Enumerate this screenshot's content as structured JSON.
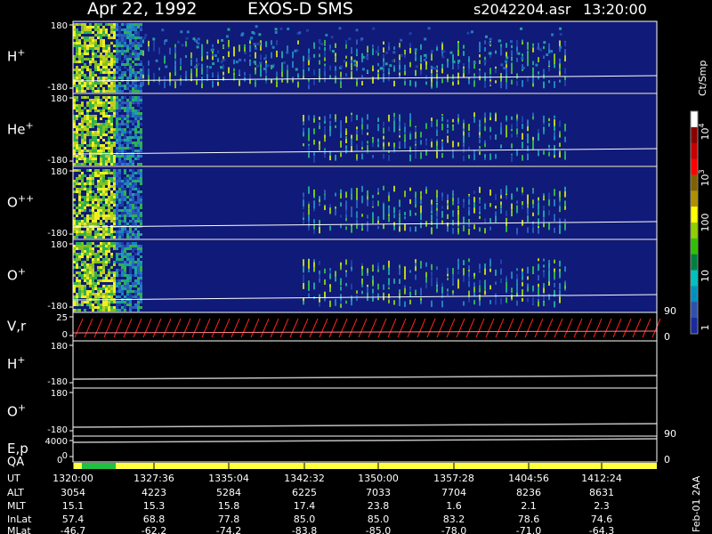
{
  "header": {
    "date": "Apr 22, 1992",
    "instrument": "EXOS-D SMS",
    "file": "s2042204.asr",
    "time": "13:20:00"
  },
  "colorbar": {
    "unit": "Ct/Smp",
    "ticks": [
      {
        "label": "10",
        "sup": "4",
        "value": 10000
      },
      {
        "label": "10",
        "sup": "3",
        "value": 1000
      },
      {
        "label": "100",
        "sup": "",
        "value": 100
      },
      {
        "label": "10",
        "sup": "",
        "value": 10
      },
      {
        "label": "1",
        "sup": "",
        "value": 1
      }
    ],
    "colors": [
      "#ffffff",
      "#8b0000",
      "#c80000",
      "#ff0000",
      "#806000",
      "#b09000",
      "#ffff00",
      "#90d000",
      "#30c000",
      "#008040",
      "#00c0c0",
      "#0090c0",
      "#3050b0",
      "#1a2aa0"
    ]
  },
  "side_labels": [
    "90",
    "0",
    "90",
    "0"
  ],
  "footer_side": "Feb-01 2AA",
  "chart_data": [
    {
      "type": "heatmap",
      "name": "H",
      "sup": "+",
      "ylim": [
        -180,
        180
      ],
      "ticks": [
        "180",
        "-180"
      ],
      "bg": "#101a78"
    },
    {
      "type": "heatmap",
      "name": "He",
      "sup": "+",
      "ylim": [
        -180,
        180
      ],
      "ticks": [
        "180",
        "-180"
      ],
      "bg": "#101a78"
    },
    {
      "type": "heatmap",
      "name": "O",
      "sup": "++",
      "ylim": [
        -180,
        180
      ],
      "ticks": [
        "180",
        "-180"
      ],
      "bg": "#101a78"
    },
    {
      "type": "heatmap",
      "name": "O",
      "sup": "+",
      "ylim": [
        -180,
        180
      ],
      "ticks": [
        "180",
        "-180"
      ],
      "bg": "#101a78"
    },
    {
      "type": "line",
      "name": "V,r",
      "sup": "",
      "ticks": [
        "25",
        "0"
      ],
      "bg": "#000000"
    },
    {
      "type": "line",
      "name": "H",
      "sup": "+",
      "ylim": [
        -180,
        180
      ],
      "ticks": [
        "180",
        "-180"
      ],
      "bg": "#000000"
    },
    {
      "type": "line",
      "name": "O",
      "sup": "+",
      "ylim": [
        -180,
        180
      ],
      "ticks": [
        "180",
        "-180"
      ],
      "bg": "#000000"
    },
    {
      "type": "line",
      "name": "E,p",
      "sup": "",
      "ticks": [
        "4000",
        "0"
      ],
      "bg": "#000000"
    }
  ],
  "qa": {
    "label": "QA",
    "tick": "0"
  },
  "ephemeris": {
    "labels": [
      "UT",
      "ALT",
      "MLT",
      "InLat",
      "MLat"
    ],
    "columns": [
      [
        "1320:00",
        "3054",
        "15.1",
        "57.4",
        "-46.7"
      ],
      [
        "1327:36",
        "4223",
        "15.3",
        "68.8",
        "-62.2"
      ],
      [
        "1335:04",
        "5284",
        "15.8",
        "77.8",
        "-74.2"
      ],
      [
        "1342:32",
        "6225",
        "17.4",
        "85.0",
        "-83.8"
      ],
      [
        "1350:00",
        "7033",
        "23.8",
        "85.0",
        "-85.0"
      ],
      [
        "1357:28",
        "7704",
        "1.6",
        "83.2",
        "-78.0"
      ],
      [
        "1404:56",
        "8236",
        "2.1",
        "78.6",
        "-71.0"
      ],
      [
        "1412:24",
        "8631",
        "2.3",
        "74.6",
        "-64.3"
      ]
    ]
  }
}
